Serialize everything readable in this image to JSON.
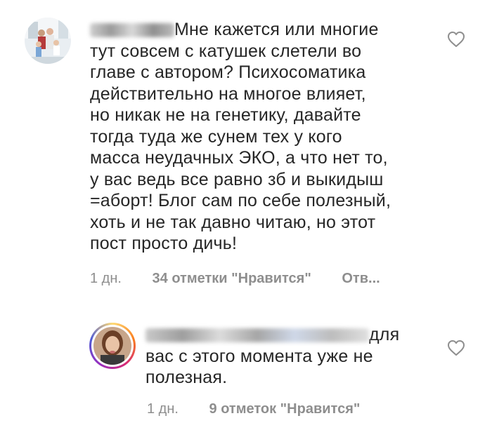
{
  "comments": [
    {
      "text_lines": [
        "Мне кажется или многие",
        "тут совсем с катушек слетели во",
        "главе с автором? Психосоматика",
        "действительно на многое влияет,",
        "но никак не на генетику, давайте",
        "тогда туда же сунем тех у кого",
        "масса неудачных ЭКО, а что нет то,",
        "у вас ведь все равно зб и выкидыш",
        "=аборт! Блог сам по себе полезный,",
        "хоть и не так давно читаю, но этот",
        "пост просто дичь!"
      ],
      "time": "1 дн.",
      "likes": "34 отметки \"Нравится\"",
      "reply": "Отв...",
      "avatar_icon": "family-photo-avatar",
      "like_icon": "heart-outline-icon"
    },
    {
      "text_lines": [
        "для",
        "вас с этого момента уже не",
        "полезная."
      ],
      "time": "1 дн.",
      "likes": "9 отметок \"Нравится\"",
      "avatar_icon": "woman-photo-avatar",
      "like_icon": "heart-outline-icon",
      "avatar_ring_color": "#c13584"
    }
  ]
}
